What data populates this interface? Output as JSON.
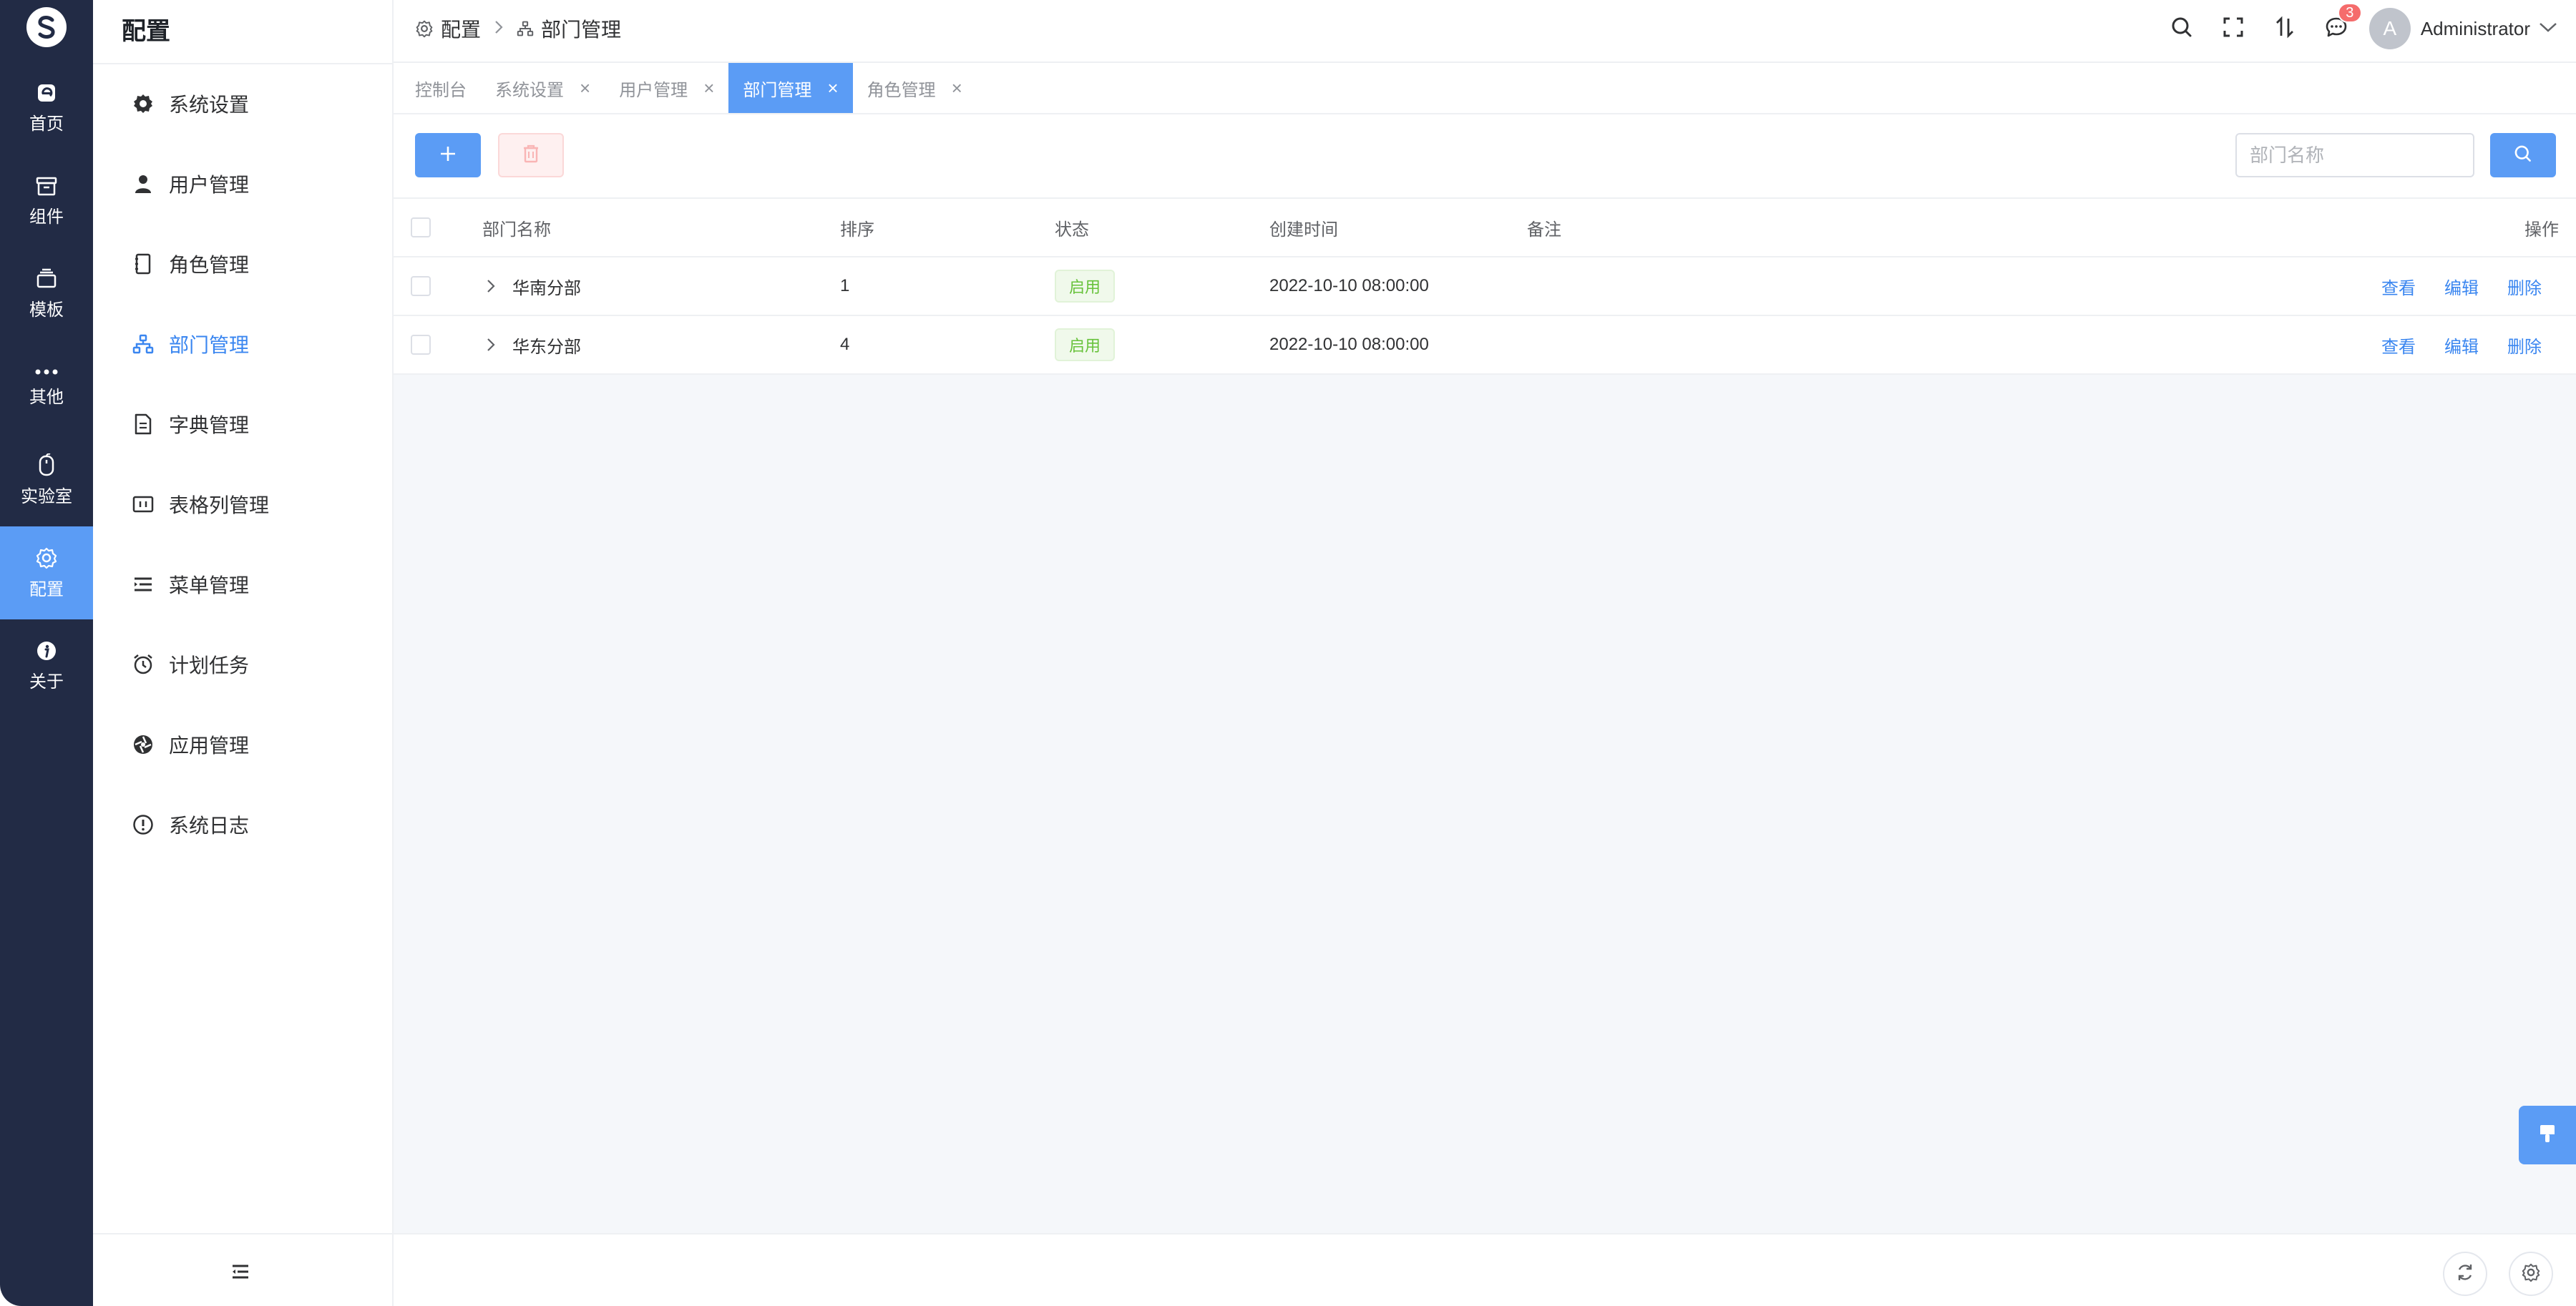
{
  "rail": {
    "items": [
      {
        "label": "首页",
        "icon": "home-icon"
      },
      {
        "label": "组件",
        "icon": "box-icon"
      },
      {
        "label": "模板",
        "icon": "layers-icon"
      },
      {
        "label": "其他",
        "icon": "more-icon"
      },
      {
        "label": "实验室",
        "icon": "mouse-icon"
      },
      {
        "label": "配置",
        "icon": "gear-icon",
        "active": true
      },
      {
        "label": "关于",
        "icon": "info-icon"
      }
    ]
  },
  "submenu": {
    "title": "配置",
    "items": [
      {
        "label": "系统设置",
        "icon": "cog-icon"
      },
      {
        "label": "用户管理",
        "icon": "user-icon"
      },
      {
        "label": "角色管理",
        "icon": "notebook-icon"
      },
      {
        "label": "部门管理",
        "icon": "org-icon",
        "active": true
      },
      {
        "label": "字典管理",
        "icon": "document-icon"
      },
      {
        "label": "表格列管理",
        "icon": "table-columns-icon"
      },
      {
        "label": "菜单管理",
        "icon": "menu-list-icon"
      },
      {
        "label": "计划任务",
        "icon": "alarm-clock-icon"
      },
      {
        "label": "应用管理",
        "icon": "aperture-icon"
      },
      {
        "label": "系统日志",
        "icon": "warning-circle-icon"
      }
    ]
  },
  "breadcrumb": {
    "root": "配置",
    "current": "部门管理"
  },
  "header": {
    "notification_count": "3",
    "avatar_letter": "A",
    "user_name": "Administrator"
  },
  "tabs": [
    {
      "label": "控制台",
      "closable": false
    },
    {
      "label": "系统设置",
      "closable": true
    },
    {
      "label": "用户管理",
      "closable": true
    },
    {
      "label": "部门管理",
      "closable": true,
      "active": true
    },
    {
      "label": "角色管理",
      "closable": true
    }
  ],
  "toolbar": {
    "search_placeholder": "部门名称"
  },
  "table": {
    "columns": [
      "部门名称",
      "排序",
      "状态",
      "创建时间",
      "备注",
      "操作"
    ],
    "rows": [
      {
        "name": "华南分部",
        "sort": "1",
        "status": "启用",
        "created": "2022-10-10 08:00:00",
        "remark": ""
      },
      {
        "name": "华东分部",
        "sort": "4",
        "status": "启用",
        "created": "2022-10-10 08:00:00",
        "remark": ""
      }
    ],
    "actions": [
      "查看",
      "编辑",
      "删除"
    ]
  },
  "colors": {
    "rail_bg": "#222b45",
    "accent": "#5b9cf5",
    "success": "#67c23a",
    "danger": "#f56c6c"
  }
}
